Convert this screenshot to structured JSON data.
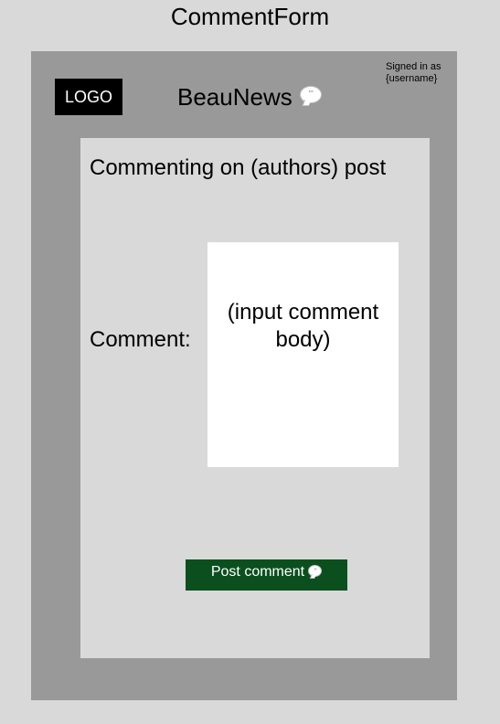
{
  "frame_title": "CommentForm",
  "header": {
    "logo_text": "LOGO",
    "brand_name": "BeauNews",
    "brand_icon": "speech-bubble-icon",
    "signed_in_line1": "Signed in as",
    "signed_in_line2": "{username}"
  },
  "form": {
    "heading": "Commenting on (authors) post",
    "comment_label": "Comment:",
    "comment_placeholder_line1": "(input comment",
    "comment_placeholder_line2": "body)",
    "submit_label": "Post comment",
    "submit_icon": "speech-bubble-icon"
  },
  "colors": {
    "page_background": "#d9d9d9",
    "app_background": "#999999",
    "panel_background": "#d9d9d9",
    "logo_background": "#000000",
    "input_background": "#ffffff",
    "button_background": "#0b4f1f",
    "button_text": "#ffffff"
  }
}
